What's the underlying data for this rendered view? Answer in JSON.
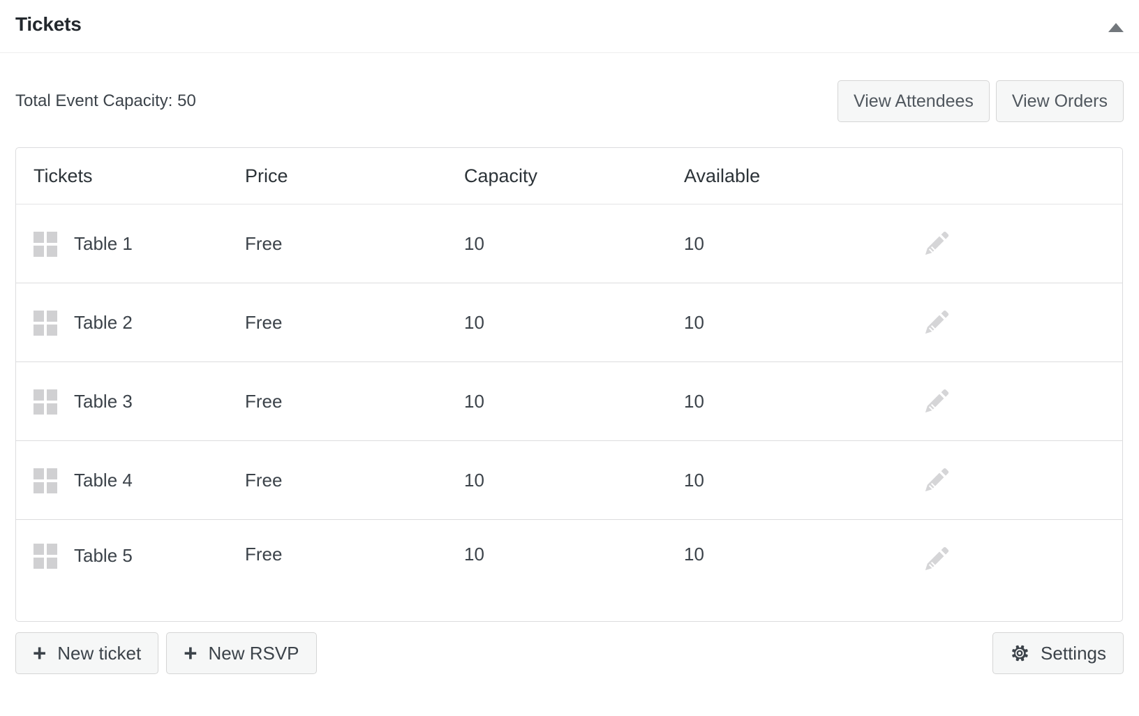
{
  "panel": {
    "title": "Tickets",
    "toggle_icon": "triangle-up-icon",
    "toggle_state": "expanded"
  },
  "summary": {
    "capacity_label": "Total Event Capacity: 50"
  },
  "top_actions": [
    {
      "label": "View Attendees",
      "name": "view-attendees-button"
    },
    {
      "label": "View Orders",
      "name": "view-orders-button"
    }
  ],
  "table": {
    "columns": [
      "Tickets",
      "Price",
      "Capacity",
      "Available"
    ],
    "row_icons": {
      "drag": "drag-handle-icon",
      "edit": "pencil-edit-icon"
    },
    "rows": [
      {
        "name": "Table 1",
        "price": "Free",
        "capacity": "10",
        "available": "10"
      },
      {
        "name": "Table 2",
        "price": "Free",
        "capacity": "10",
        "available": "10"
      },
      {
        "name": "Table 3",
        "price": "Free",
        "capacity": "10",
        "available": "10"
      },
      {
        "name": "Table 4",
        "price": "Free",
        "capacity": "10",
        "available": "10"
      },
      {
        "name": "Table 5",
        "price": "Free",
        "capacity": "10",
        "available": "10"
      }
    ]
  },
  "footer": {
    "new_ticket_label": "New ticket",
    "new_rsvp_label": "New RSVP",
    "settings_label": "Settings",
    "plus_glyph": "+"
  },
  "colors": {
    "panel_bg": "#ffffff",
    "title_text": "#23282d",
    "body_text": "#3c434a",
    "button_bg": "#f6f7f7",
    "button_border": "#d5d5d5",
    "table_border": "#dcdcde",
    "icon_muted": "#d0d0d2",
    "arrow": "#72777c"
  }
}
